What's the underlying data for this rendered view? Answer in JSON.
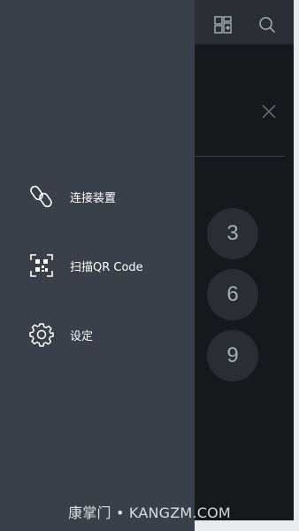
{
  "drawer": {
    "items": [
      {
        "label": "连接装置",
        "icon": "link-icon"
      },
      {
        "label": "扫描QR Code",
        "icon": "qr-scan-icon"
      },
      {
        "label": "设定",
        "icon": "gear-icon"
      }
    ]
  },
  "app": {
    "top_icons": [
      "screen-mirror-icon",
      "search-icon"
    ],
    "keys": [
      "3",
      "6",
      "9"
    ]
  },
  "watermark": "康掌门 • KANGZM.COM",
  "colors": {
    "drawer_bg": "#3a4049",
    "app_bg": "#16191c",
    "key_bg": "#2a2e33",
    "text": "#ffffff"
  }
}
